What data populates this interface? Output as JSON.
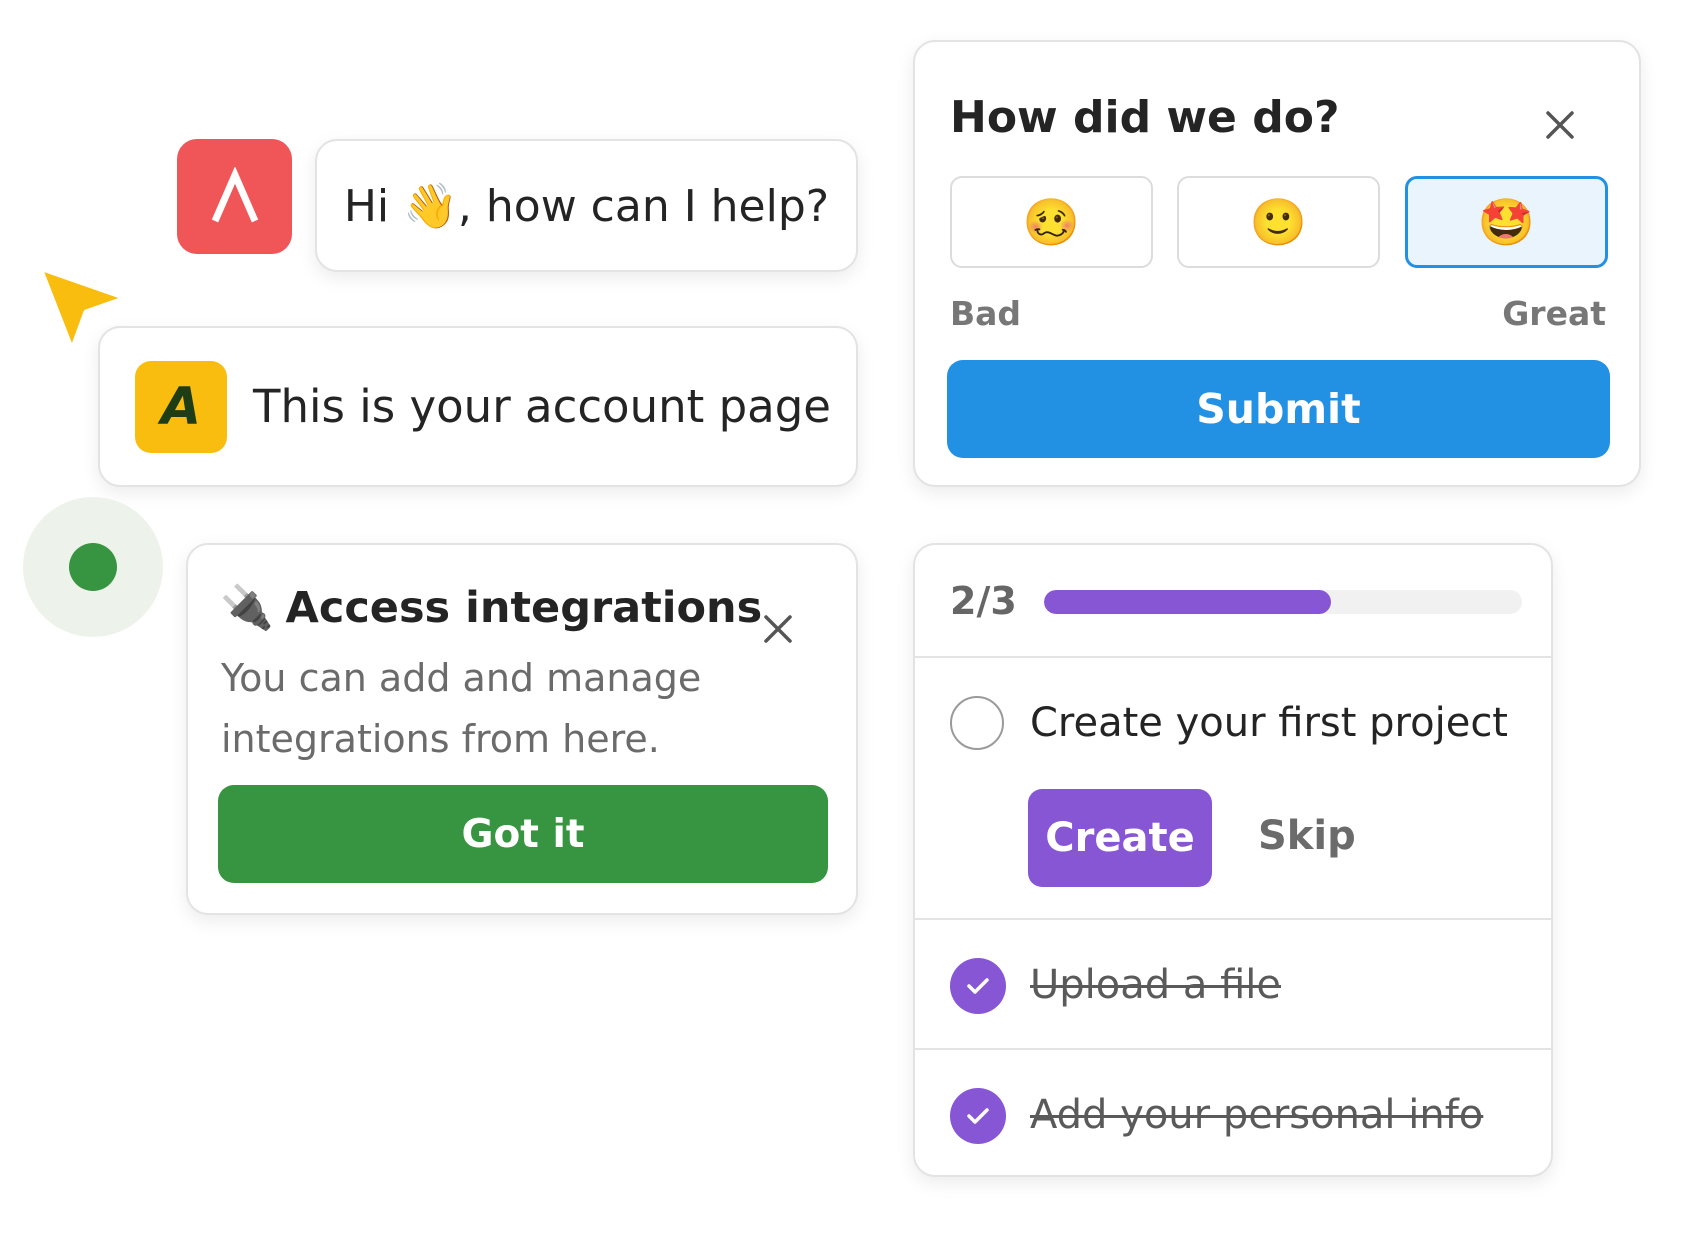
{
  "chat": {
    "greeting": "Hi 👋, how can I help?"
  },
  "account": {
    "logo_letter": "A",
    "message": "This is your account page"
  },
  "hint": {
    "icon": "🔌",
    "title": "Access integrations",
    "body": "You can add and manage integrations from here.",
    "button_label": "Got it"
  },
  "survey": {
    "title": "How did we do?",
    "options": [
      "🥴",
      "🙂",
      "🤩"
    ],
    "selected_index": 2,
    "scale_low": "Bad",
    "scale_high": "Great",
    "submit_label": "Submit"
  },
  "checklist": {
    "progress_label": "2/3",
    "progress_fraction": 0.6,
    "current_step": {
      "title": "Create your first project",
      "primary_label": "Create",
      "secondary_label": "Skip"
    },
    "completed_steps": [
      "Upload a file",
      "Add your personal info"
    ]
  },
  "colors": {
    "app_logo": "#f05658",
    "account_logo": "#f9bd10",
    "cursor": "#f9bd10",
    "beacon": "#379440",
    "hint_button": "#379440",
    "survey_accent": "#2391e3",
    "checklist_accent": "#8756d4"
  }
}
